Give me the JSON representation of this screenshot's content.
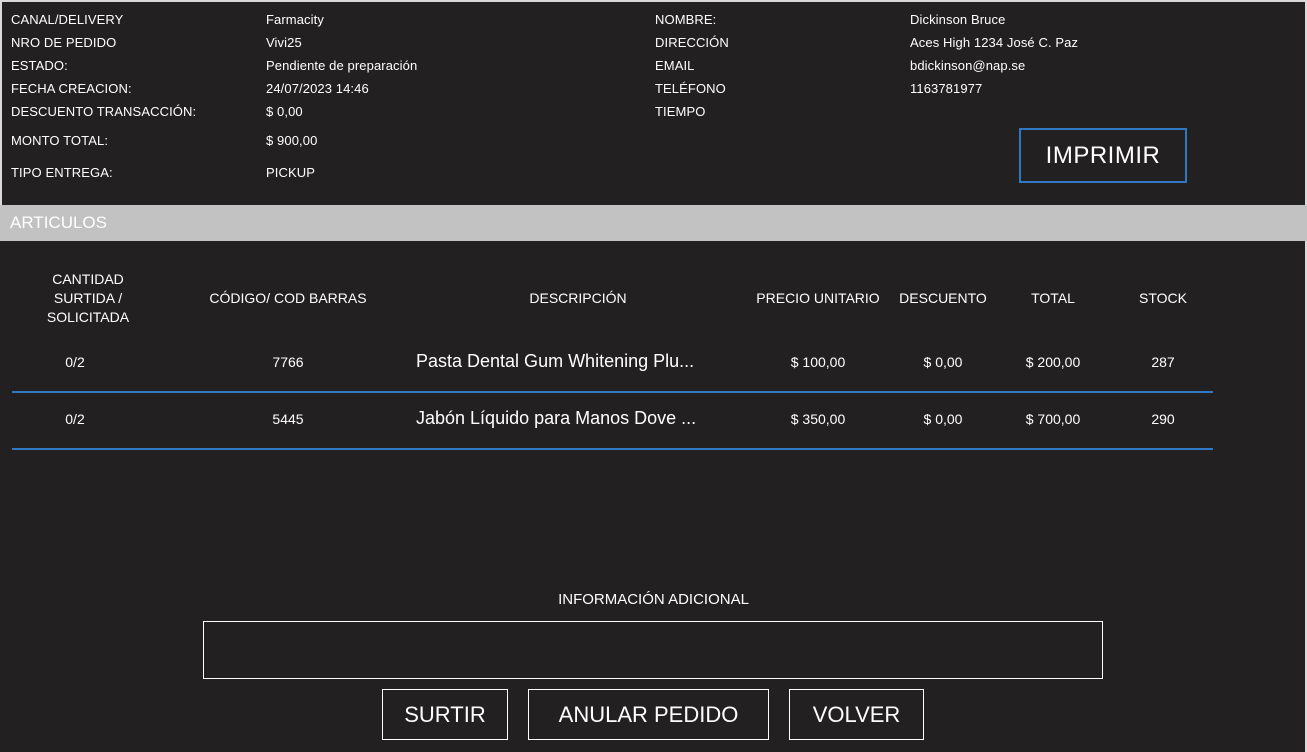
{
  "order": {
    "left_fields": [
      {
        "label": "CANAL/DELIVERY",
        "value": "Farmacity"
      },
      {
        "label": "NRO DE PEDIDO",
        "value": "Vivi25"
      },
      {
        "label": "ESTADO:",
        "value": "Pendiente de preparación"
      },
      {
        "label": "FECHA CREACION:",
        "value": "24/07/2023 14:46"
      },
      {
        "label": "DESCUENTO TRANSACCIÓN:",
        "value": "$ 0,00"
      },
      {
        "label": "MONTO TOTAL:",
        "value": "$ 900,00"
      },
      {
        "label": "TIPO ENTREGA:",
        "value": "PICKUP"
      }
    ],
    "right_fields": [
      {
        "label": "NOMBRE:",
        "value": "Dickinson Bruce"
      },
      {
        "label": "DIRECCIÓN",
        "value": "Aces High 1234 José C. Paz"
      },
      {
        "label": "EMAIL",
        "value": "bdickinson@nap.se"
      },
      {
        "label": "TELÉFONO",
        "value": "1163781977"
      },
      {
        "label": "TIEMPO",
        "value": ""
      }
    ],
    "print_label": "IMPRIMIR"
  },
  "articles": {
    "section_title": "ARTICULOS",
    "headers": {
      "qty": "CANTIDAD SURTIDA / SOLICITADA",
      "code": "CÓDIGO/ COD BARRAS",
      "description": "DESCRIPCIÓN",
      "unit_price": "PRECIO UNITARIO",
      "discount": "DESCUENTO",
      "total": "TOTAL",
      "stock": "STOCK"
    },
    "rows": [
      {
        "qty": "0/2",
        "code": "7766",
        "description": "Pasta Dental Gum Whitening Plu...",
        "unit_price": "$ 100,00",
        "discount": "$ 0,00",
        "total": "$ 200,00",
        "stock": "287"
      },
      {
        "qty": "0/2",
        "code": "5445",
        "description": "Jabón Líquido para Manos Dove ...",
        "unit_price": "$ 350,00",
        "discount": "$ 0,00",
        "total": "$ 700,00",
        "stock": "290"
      }
    ]
  },
  "additional": {
    "label": "INFORMACIÓN ADICIONAL",
    "value": ""
  },
  "actions": {
    "fulfill": "SURTIR",
    "cancel": "ANULAR PEDIDO",
    "back": "VOLVER"
  },
  "colors": {
    "background": "#232021",
    "accent": "#2f78c4",
    "section_bar": "#c2c2c2"
  }
}
